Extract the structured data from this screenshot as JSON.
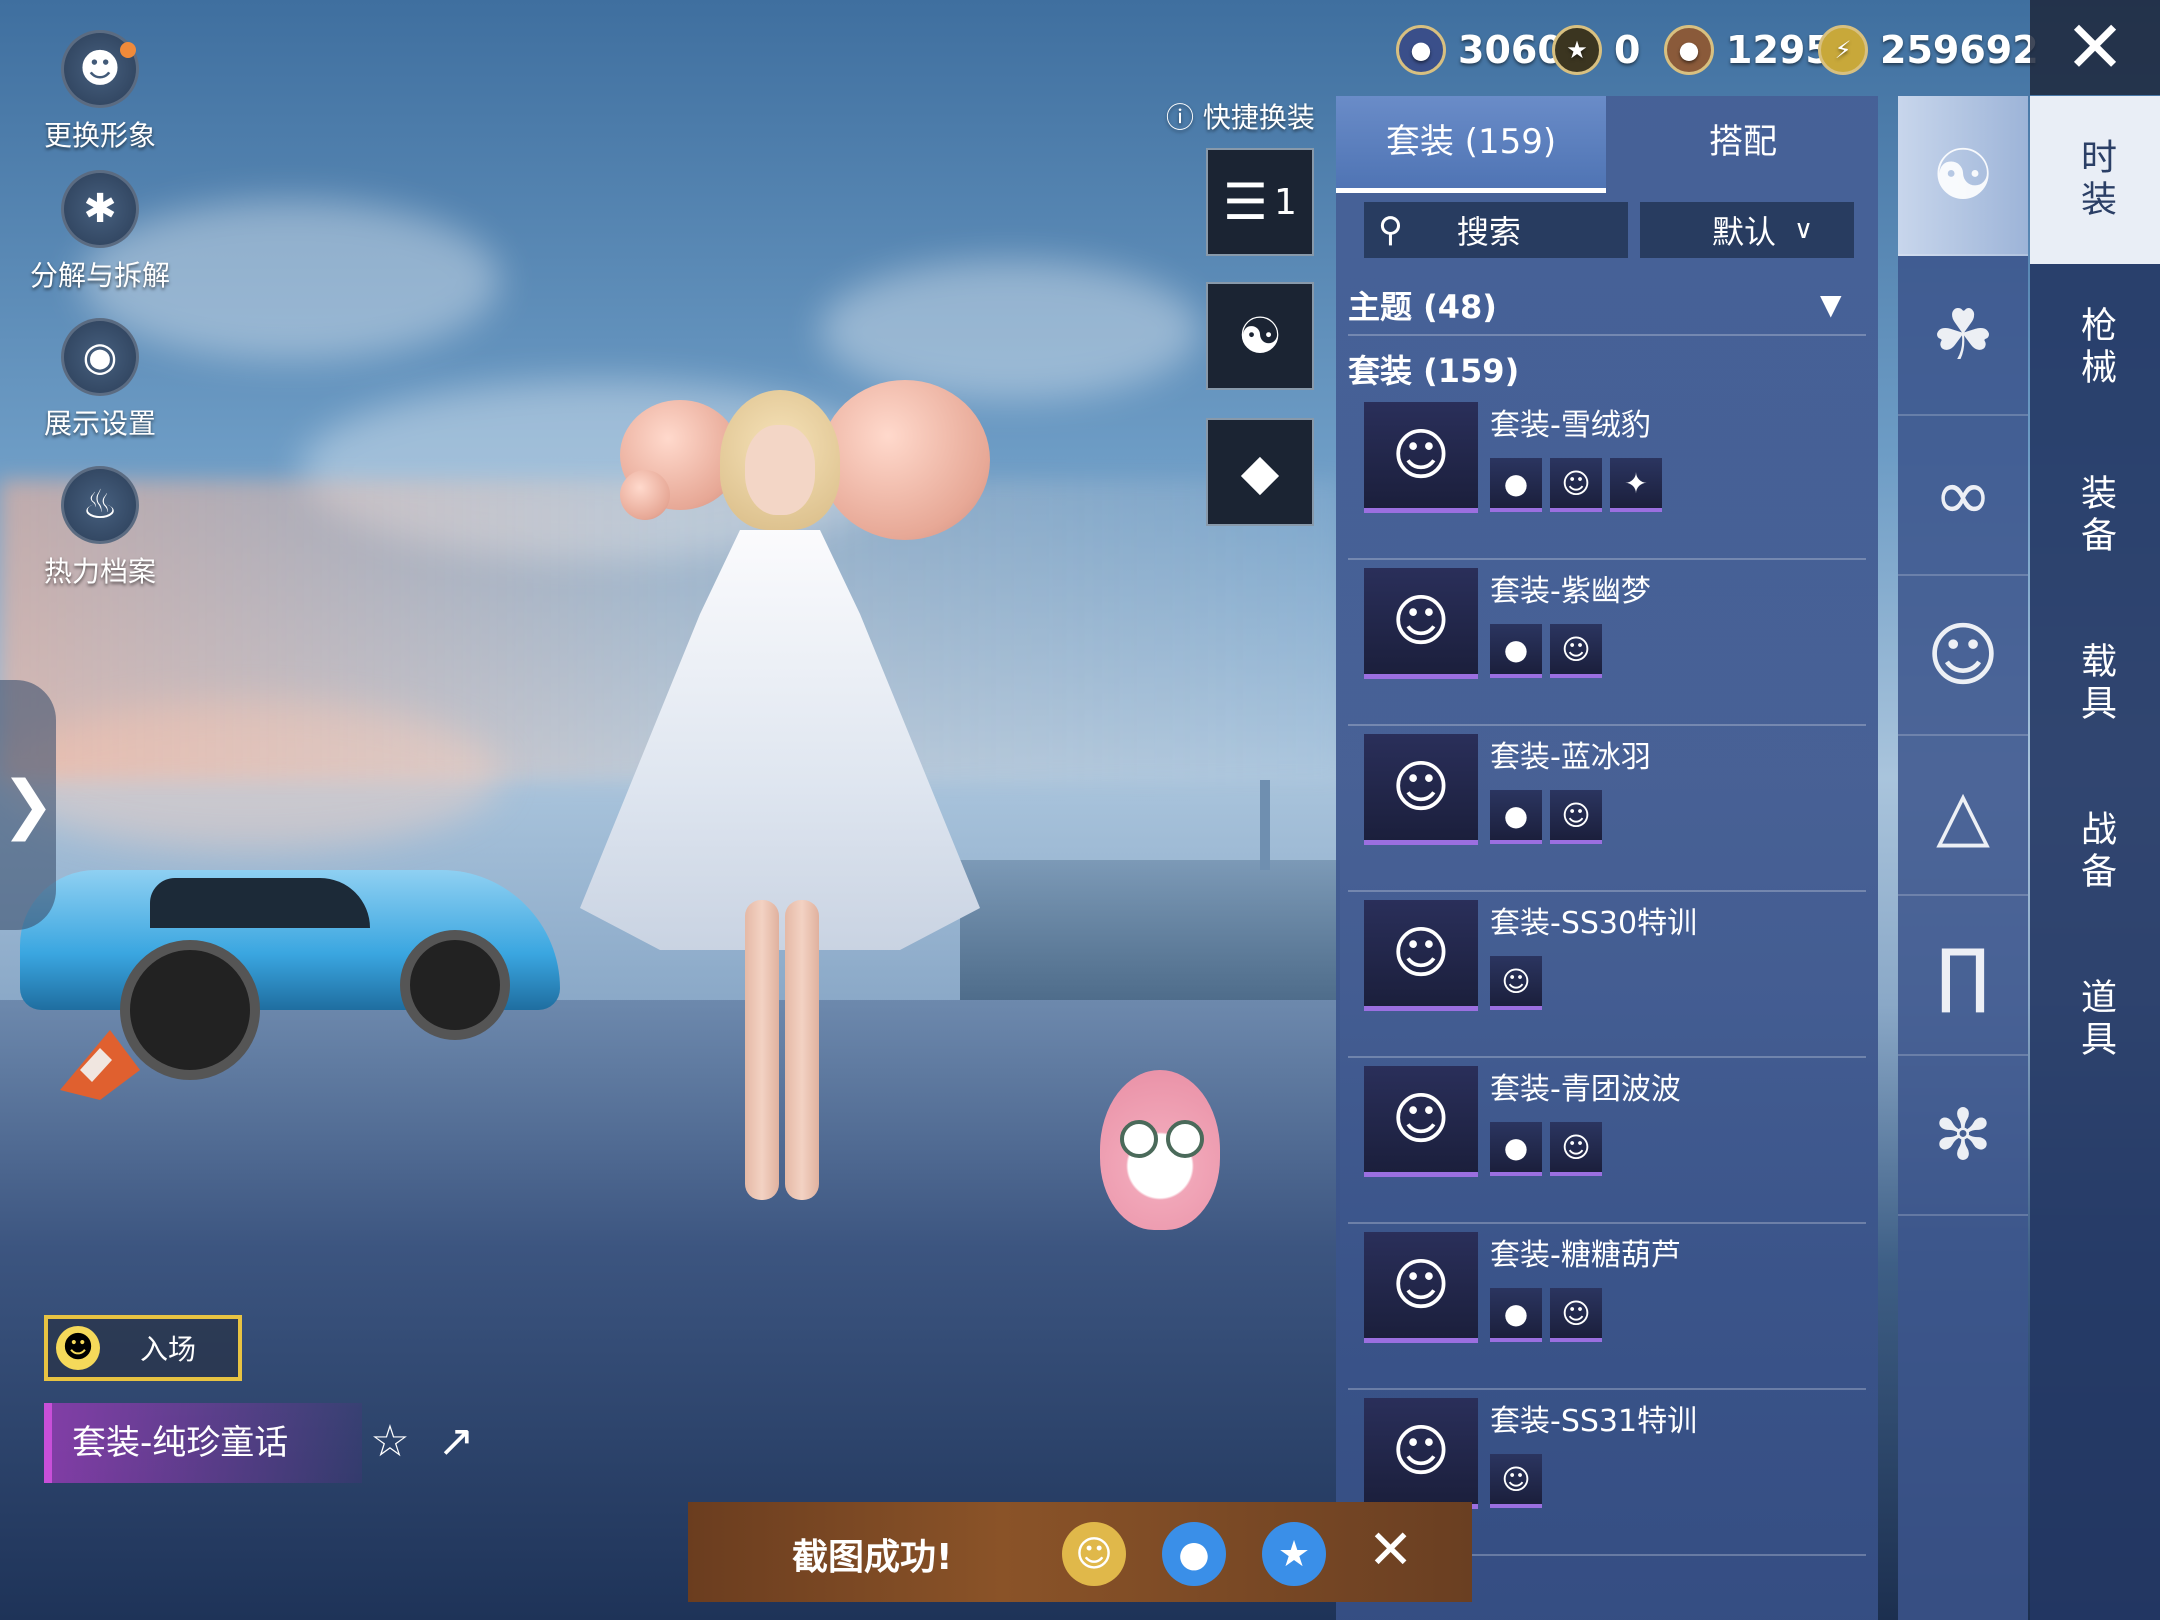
{
  "left_menu": {
    "change_avatar": "更换形象",
    "decompose": "分解与拆解",
    "display_settings": "展示设置",
    "heat_archive": "热力档案"
  },
  "currency": {
    "c1": "3060",
    "c2": "0",
    "c3": "1295",
    "c4": "259692"
  },
  "quick_change": {
    "label": "快捷换装",
    "slot1": "1"
  },
  "tabs": {
    "sets": "套装 (159)",
    "mix": "搭配"
  },
  "search": {
    "placeholder": "搜索",
    "sort": "默认"
  },
  "sections": {
    "theme": "主题 (48)",
    "sets": "套装 (159)"
  },
  "items": [
    {
      "name": "套装-雪绒豹"
    },
    {
      "name": "套装-紫幽梦"
    },
    {
      "name": "套装-蓝冰羽"
    },
    {
      "name": "套装-SS30特训"
    },
    {
      "name": "套装-青团波波"
    },
    {
      "name": "套装-糖糖葫芦"
    },
    {
      "name": "套装-SS31特训"
    }
  ],
  "right_tabs": [
    "时装",
    "枪械",
    "装备",
    "载具",
    "战备",
    "道具"
  ],
  "bottom": {
    "entry": "入场",
    "outfit_name": "套装-纯珍童话"
  },
  "toast": {
    "text": "截图成功!"
  },
  "icons": {
    "close": "close-icon",
    "search": "search-icon",
    "star": "star-icon",
    "share": "share-icon"
  }
}
